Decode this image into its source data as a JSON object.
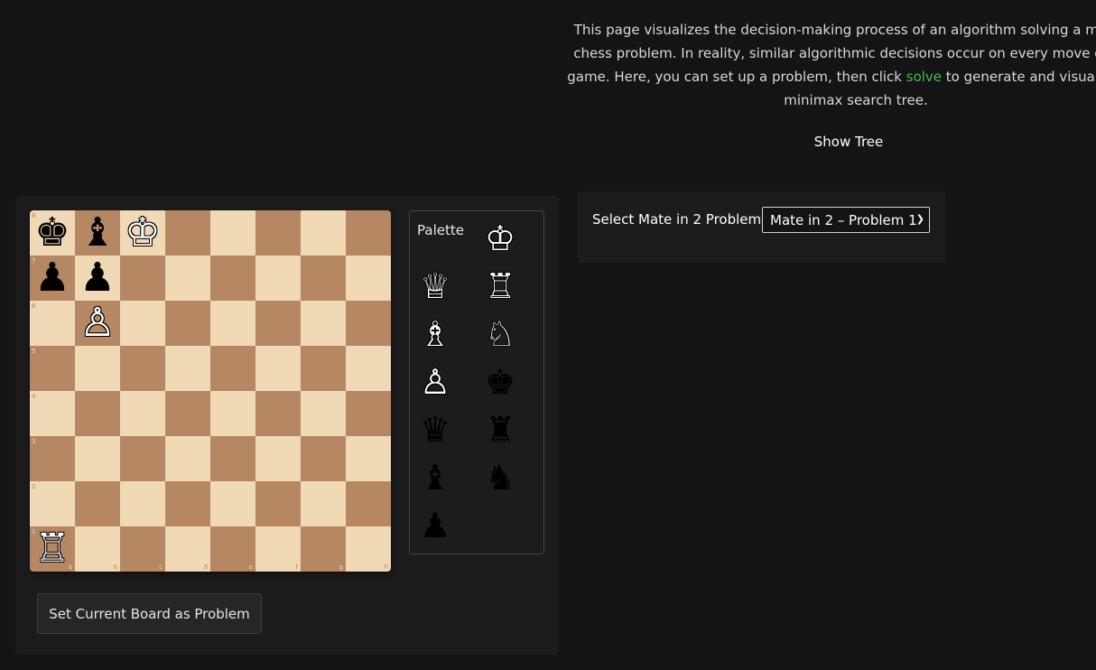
{
  "intro": {
    "line1": "This page visualizes the decision-making process of an algorithm solving a mate-in",
    "line2": "chess problem. In reality, similar algorithmic decisions occur on every move during",
    "line3_pre": "game. Here, you can set up a problem, then click ",
    "line3_link": "solve",
    "line3_post": " to generate and visualize the",
    "line4": "minimax search tree."
  },
  "show_tree_label": "Show Tree",
  "board": {
    "ranks": [
      "8",
      "7",
      "6",
      "5",
      "4",
      "3",
      "2",
      "1"
    ],
    "files": [
      "a",
      "b",
      "c",
      "d",
      "e",
      "f",
      "g",
      "h"
    ],
    "pieces": {
      "a8": {
        "glyph": "♚",
        "color": "b",
        "icon": "black-king-icon"
      },
      "b8": {
        "glyph": "♝",
        "color": "b",
        "icon": "black-bishop-icon"
      },
      "c8": {
        "glyph": "♔",
        "color": "w",
        "icon": "white-king-icon"
      },
      "a7": {
        "glyph": "♟",
        "color": "b",
        "icon": "black-pawn-icon"
      },
      "b7": {
        "glyph": "♟",
        "color": "b",
        "icon": "black-pawn-icon"
      },
      "b6": {
        "glyph": "♙",
        "color": "w",
        "icon": "white-pawn-icon"
      },
      "a1": {
        "glyph": "♖",
        "color": "w",
        "icon": "white-rook-icon"
      }
    }
  },
  "palette": {
    "label": "Palette",
    "pieces": [
      {
        "glyph": "♔",
        "color": "w",
        "icon": "white-king-icon"
      },
      {
        "glyph": "♕",
        "color": "w",
        "icon": "white-queen-icon"
      },
      {
        "glyph": "♖",
        "color": "w",
        "icon": "white-rook-icon"
      },
      {
        "glyph": "♗",
        "color": "w",
        "icon": "white-bishop-icon"
      },
      {
        "glyph": "♘",
        "color": "w",
        "icon": "white-knight-icon"
      },
      {
        "glyph": "♙",
        "color": "w",
        "icon": "white-pawn-icon"
      },
      {
        "glyph": "♚",
        "color": "b",
        "icon": "black-king-icon"
      },
      {
        "glyph": "♛",
        "color": "b",
        "icon": "black-queen-icon"
      },
      {
        "glyph": "♜",
        "color": "b",
        "icon": "black-rook-icon"
      },
      {
        "glyph": "♝",
        "color": "b",
        "icon": "black-bishop-icon"
      },
      {
        "glyph": "♞",
        "color": "b",
        "icon": "black-knight-icon"
      },
      {
        "glyph": "♟",
        "color": "b",
        "icon": "black-pawn-icon"
      }
    ]
  },
  "set_board_button": "Set Current Board as Problem",
  "problem_select": {
    "label": "Select Mate in 2 Problem:",
    "selected": "Mate in 2 – Problem 1"
  },
  "colors": {
    "background": "#141414",
    "panel": "#1c1c1c",
    "light_square": "#f0d9b5",
    "dark_square": "#b58863",
    "link": "#3fbf52"
  }
}
